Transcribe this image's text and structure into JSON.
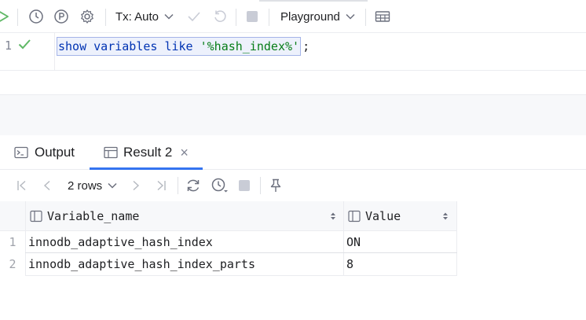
{
  "toolbar": {
    "tx_label": "Tx: Auto",
    "playground_label": "Playground"
  },
  "editor": {
    "line_number": "1",
    "code_keyword": "show variables like",
    "code_string": "'%hash_index%'",
    "code_end": ";"
  },
  "tabs": {
    "output_label": "Output",
    "result_label": "Result 2",
    "close_glyph": "×"
  },
  "results_toolbar": {
    "rows_label": "2 rows"
  },
  "table": {
    "columns": [
      "Variable_name",
      "Value"
    ],
    "rows": [
      {
        "num": "1",
        "variable_name": "innodb_adaptive_hash_index",
        "value": "ON"
      },
      {
        "num": "2",
        "variable_name": "innodb_adaptive_hash_index_parts",
        "value": "8"
      }
    ]
  },
  "colors": {
    "accent": "#3574f0",
    "run_green": "#5fb865",
    "keyword": "#0033b3",
    "string": "#067d17"
  }
}
